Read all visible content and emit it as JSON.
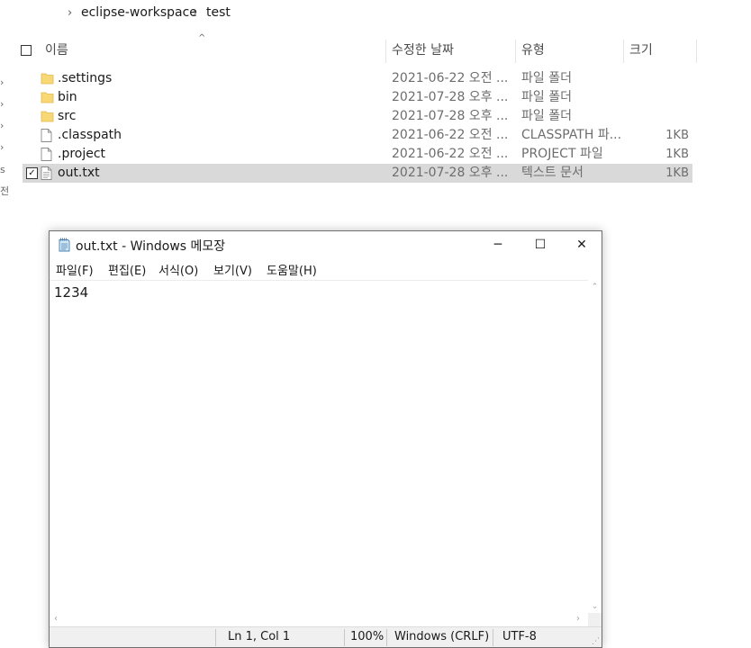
{
  "explorer": {
    "breadcrumb": {
      "separator": "›",
      "items": [
        "eclipse-workspace",
        "test"
      ]
    },
    "left_pane_fragments": [
      "s",
      "전"
    ],
    "columns": {
      "name": "이름",
      "date": "수정한 날짜",
      "type": "유형",
      "size": "크기"
    },
    "files": [
      {
        "name": ".settings",
        "date": "2021-06-22 오전 ...",
        "type": "파일 폴더",
        "size": "",
        "icon": "folder-icon",
        "selected": false
      },
      {
        "name": "bin",
        "date": "2021-07-28 오후 ...",
        "type": "파일 폴더",
        "size": "",
        "icon": "folder-icon",
        "selected": false
      },
      {
        "name": "src",
        "date": "2021-07-28 오후 ...",
        "type": "파일 폴더",
        "size": "",
        "icon": "folder-icon",
        "selected": false
      },
      {
        "name": ".classpath",
        "date": "2021-06-22 오전 ...",
        "type": "CLASSPATH 파...",
        "size": "1KB",
        "icon": "file-icon",
        "selected": false
      },
      {
        "name": ".project",
        "date": "2021-06-22 오전 ...",
        "type": "PROJECT 파일",
        "size": "1KB",
        "icon": "file-icon",
        "selected": false
      },
      {
        "name": "out.txt",
        "date": "2021-07-28 오후 ...",
        "type": "텍스트 문서",
        "size": "1KB",
        "icon": "text-file-icon",
        "selected": true
      }
    ],
    "colors": {
      "selected_row": "#d9d9d9",
      "folder": "#f8d775"
    }
  },
  "notepad": {
    "title": "out.txt - Windows 메모장",
    "window_buttons": {
      "minimize": "─",
      "maximize": "☐",
      "close": "✕"
    },
    "menu": [
      "파일(F)",
      "편집(E)",
      "서식(O)",
      "보기(V)",
      "도움말(H)"
    ],
    "content": "1234",
    "status": {
      "position": "Ln 1, Col 1",
      "zoom": "100%",
      "line_ending": "Windows (CRLF)",
      "encoding": "UTF-8"
    }
  }
}
